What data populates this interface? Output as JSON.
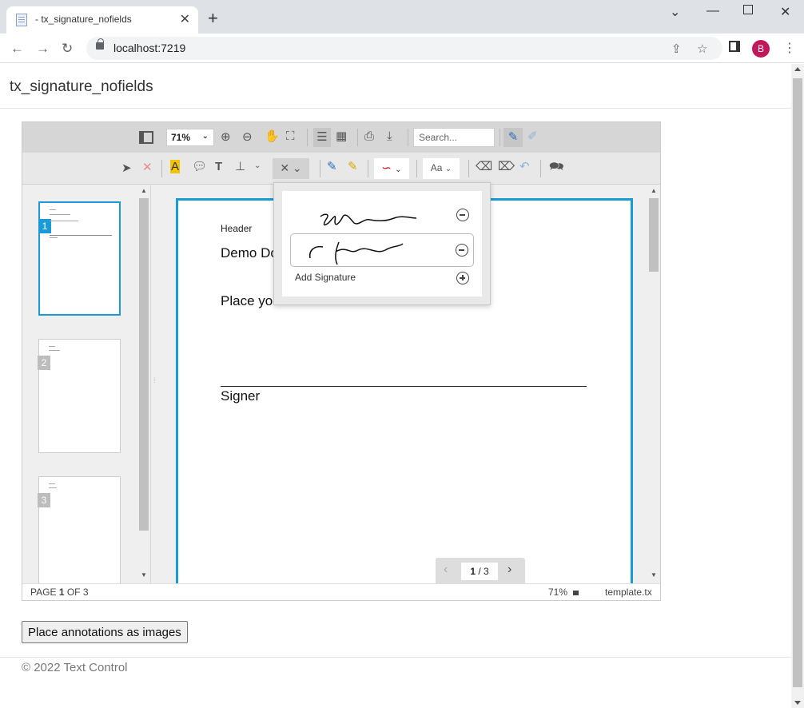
{
  "browser": {
    "tab_title": "- tx_signature_nofields",
    "url": "localhost:7219",
    "profile_initial": "B",
    "accent": "#c2185b"
  },
  "page": {
    "title": "tx_signature_nofields",
    "place_button": "Place annotations as images",
    "footer": "© 2022 Text Control"
  },
  "viewer": {
    "zoom": "71%",
    "search_placeholder": "Search...",
    "document": {
      "header": "Header",
      "title": "Demo Do",
      "place_text": "Place yo",
      "signer": "Signer"
    },
    "pager": {
      "current": "1",
      "text": " / 3"
    },
    "status": {
      "page_prefix": "PAGE",
      "page_num": "1",
      "page_suffix": "OF 3",
      "zoom": "71%",
      "filename": "template.tx"
    },
    "thumbnails": [
      "1",
      "2",
      "3"
    ],
    "signature_popup": {
      "add_label": "Add Signature"
    },
    "border_color": "#1a9ad6"
  }
}
